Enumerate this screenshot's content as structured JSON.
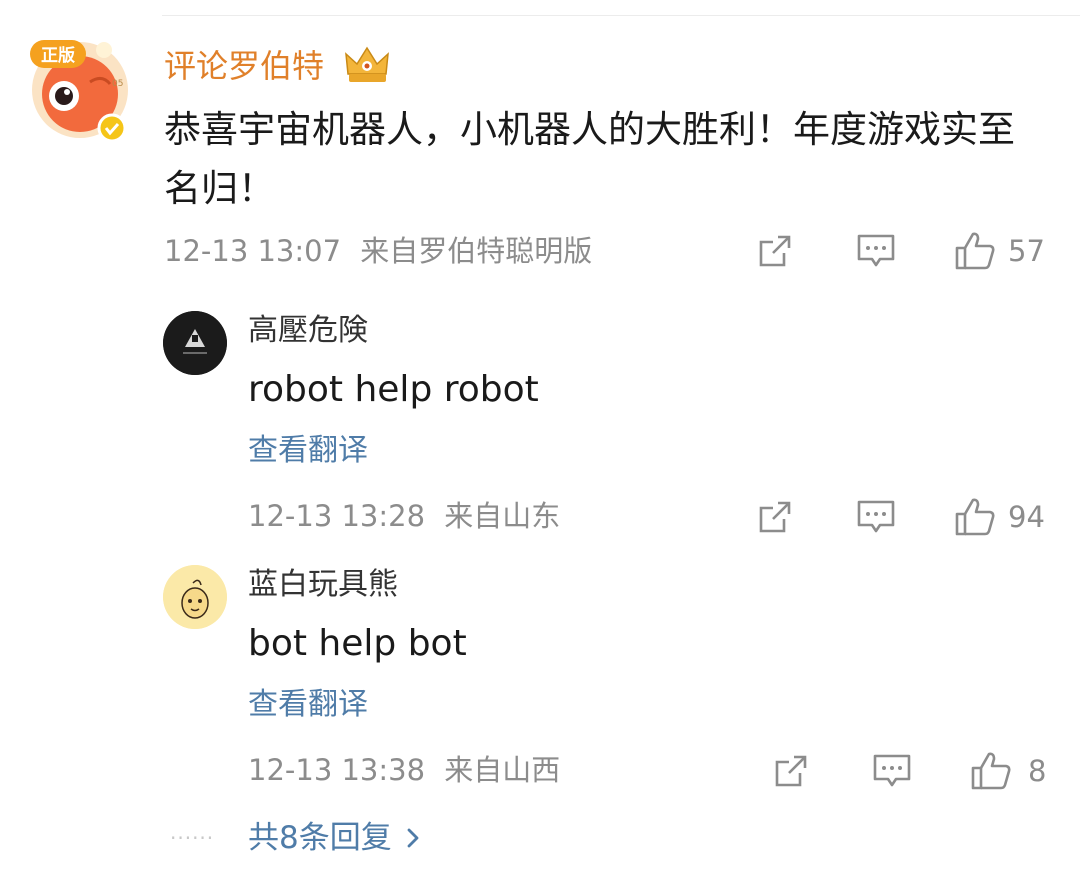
{
  "main_comment": {
    "username": "评论罗伯特",
    "avatar_badge": "正版",
    "avatar_number": "05",
    "text": "恭喜宇宙机器人，小机器人的大胜利！年度游戏实至名归！",
    "timestamp": "12-13 13:07",
    "source": "来自罗伯特聪明版",
    "likes": "57",
    "colors": {
      "username": "#e0802a",
      "verified_badge": "#f5c518"
    }
  },
  "replies": [
    {
      "username": "高壓危険",
      "text": "robot help robot",
      "translate_label": "查看翻译",
      "timestamp": "12-13 13:28",
      "source": "来自山东",
      "likes": "94"
    },
    {
      "username": "蓝白玩具熊",
      "text": "bot help bot",
      "translate_label": "查看翻译",
      "timestamp": "12-13 13:38",
      "source": "来自山西",
      "likes": "8"
    }
  ],
  "more_replies": {
    "dots": "······",
    "label": "共8条回复"
  },
  "icons": {
    "share": "share-icon",
    "comment": "comment-icon",
    "like": "thumbs-up-icon",
    "chevron": "chevron-right-icon",
    "crown": "crown-icon"
  },
  "colors": {
    "link": "#4f7ca8",
    "meta": "#8c8c8c",
    "text": "#1a1a1a"
  }
}
